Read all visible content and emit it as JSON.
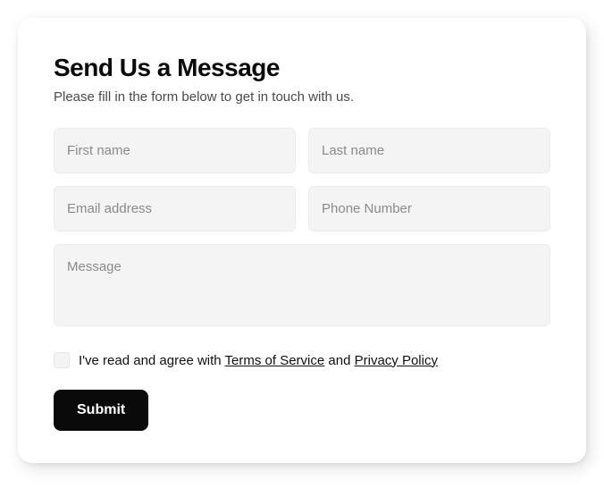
{
  "form": {
    "title": "Send Us a Message",
    "subtitle": "Please fill in the form below to get in touch with us.",
    "fields": {
      "first_name": {
        "placeholder": "First name",
        "value": ""
      },
      "last_name": {
        "placeholder": "Last name",
        "value": ""
      },
      "email": {
        "placeholder": "Email address",
        "value": ""
      },
      "phone": {
        "placeholder": "Phone Number",
        "value": ""
      },
      "message": {
        "placeholder": "Message",
        "value": ""
      }
    },
    "consent": {
      "checked": false,
      "prefix": "I've read and agree with ",
      "terms_link": "Terms of Service",
      "middle": " and ",
      "privacy_link": "Privacy Policy"
    },
    "submit_label": "Submit"
  }
}
